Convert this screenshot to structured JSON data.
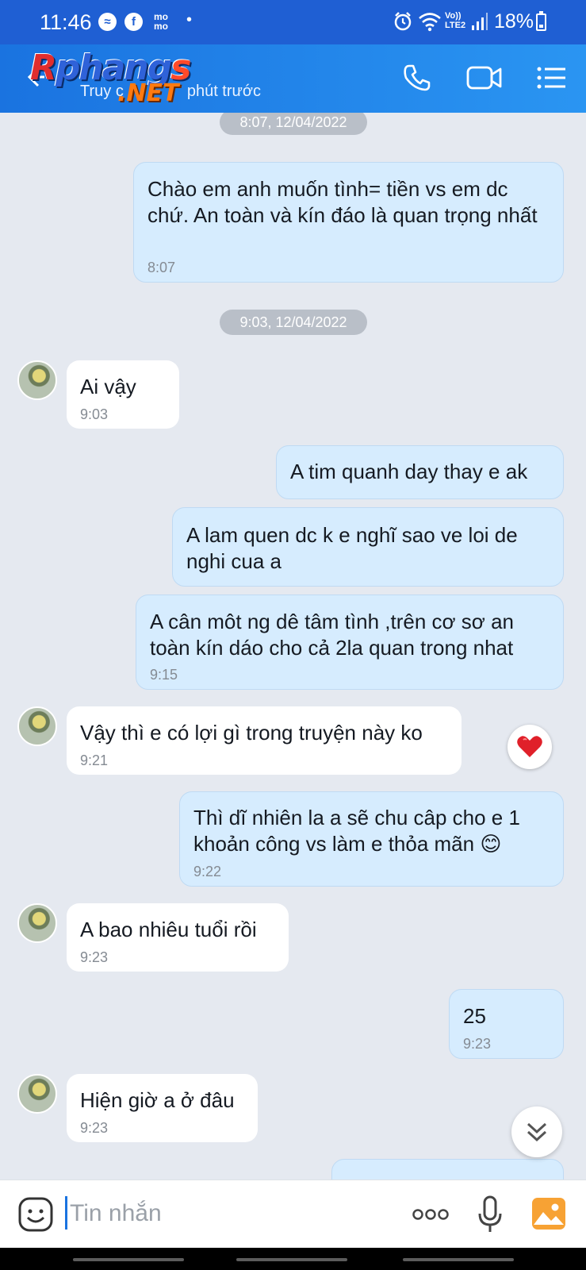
{
  "status_bar": {
    "time": "11:46",
    "app_icons": [
      "messenger-icon",
      "facebook-icon",
      "momo-icon"
    ],
    "momo_label": "mo\nmo",
    "battery": "18%",
    "network_label": "Vo))\nLTE2"
  },
  "header": {
    "logo": {
      "part1": "R",
      "part2": "phang",
      "part3": "s",
      "net": ".NET"
    },
    "subtitle": "Truy cập ... phút trước",
    "subtitle_visible": "Truy c",
    "subtitle_tail": "phút trước"
  },
  "messages": [
    {
      "type": "date",
      "text": "8:07, 12/04/2022"
    },
    {
      "type": "out",
      "text": "Chào em anh muốn  tình= tiền vs em dc chứ. An toàn và kín đáo là quan trọng nhất",
      "time": "8:07"
    },
    {
      "type": "date",
      "text": "9:03, 12/04/2022"
    },
    {
      "type": "in",
      "text": "Ai vậy",
      "time": "9:03"
    },
    {
      "type": "out",
      "text": "A tim quanh day thay e ak",
      "time": ""
    },
    {
      "type": "out",
      "text": "A lam quen dc k e nghĩ sao ve loi de nghi cua a",
      "time": ""
    },
    {
      "type": "out",
      "text": "A cân môt ng dê tâm tình ,trên cơ sơ an toàn kín dáo cho cả 2la quan trong nhat",
      "time": "9:15"
    },
    {
      "type": "in",
      "text": "Vậy thì e có lợi gì trong truyện này ko",
      "time": "9:21",
      "reaction": "heart-icon"
    },
    {
      "type": "out",
      "text": "Thì dĩ nhiên la a sẽ chu câp cho e 1 khoản công vs làm e thỏa mãn 😊",
      "time": "9:22"
    },
    {
      "type": "in",
      "text": "A bao nhiêu tuổi rồi",
      "time": "9:23"
    },
    {
      "type": "out",
      "text": "25",
      "time": "9:23"
    },
    {
      "type": "in",
      "text": "Hiện giờ a ở đâu",
      "time": "9:23"
    }
  ],
  "input": {
    "placeholder": "Tin nhắn"
  },
  "colors": {
    "status_bar": "#1f5fd3",
    "header": "#1a73e0",
    "outgoing_bubble": "#d6ecfe",
    "incoming_bubble": "#ffffff",
    "background": "#e5e9f0"
  }
}
